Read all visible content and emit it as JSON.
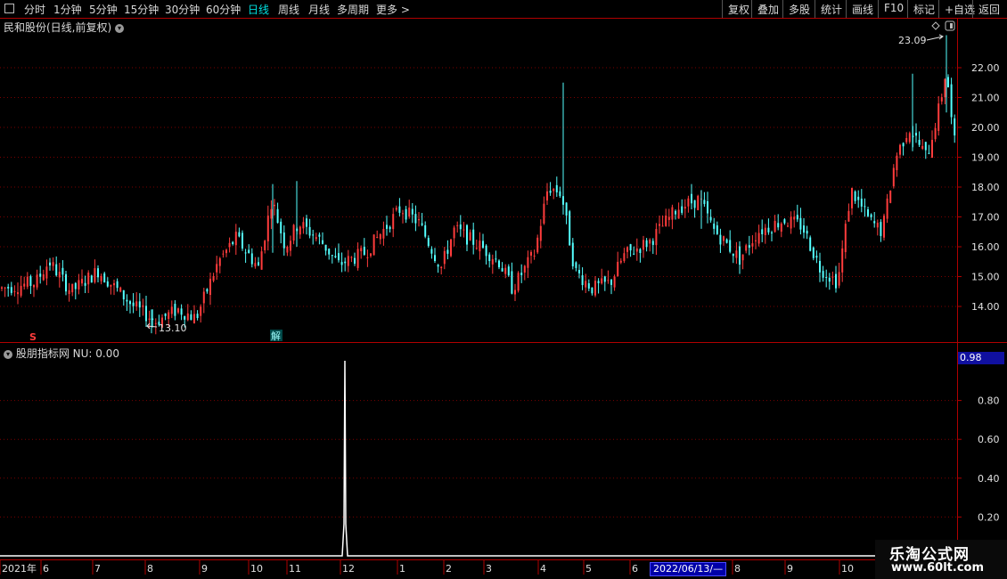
{
  "toolbar": {
    "periods": [
      "分时",
      "1分钟",
      "5分钟",
      "15分钟",
      "30分钟",
      "60分钟",
      "日线",
      "周线",
      "月线",
      "多周期",
      "更多 >"
    ],
    "active_period": "日线",
    "right": [
      "复权",
      "叠加",
      "多股",
      "统计",
      "画线",
      "F10",
      "标记",
      "+自选",
      "返回"
    ]
  },
  "main_chart": {
    "title": "民和股份(日线,前复权)",
    "price_ticks": [
      "22.00",
      "21.00",
      "20.00",
      "19.00",
      "18.00",
      "17.00",
      "16.00",
      "15.00",
      "14.00"
    ],
    "high_label": "23.09",
    "low_label": "13.10",
    "marker_s": "S",
    "marker_jie": "解"
  },
  "indicator": {
    "title": "股朋指标网 NU: 0.00",
    "current_value": "0.98",
    "ticks": [
      "0.80",
      "0.60",
      "0.40",
      "0.20"
    ]
  },
  "time_axis": {
    "labels": [
      "2021年",
      "6",
      "7",
      "8",
      "9",
      "10",
      "11",
      "12",
      "1",
      "2",
      "3",
      "4",
      "5",
      "6",
      "8",
      "9",
      "10"
    ],
    "cursor_date": "2022/06/13/—"
  },
  "watermark": {
    "title": "乐淘公式网",
    "url": "www.60lt.com"
  },
  "colors": {
    "up": "#ff3c3c",
    "down": "#54ffff",
    "grid": "#7a0000",
    "active": "#00e0e0"
  }
}
